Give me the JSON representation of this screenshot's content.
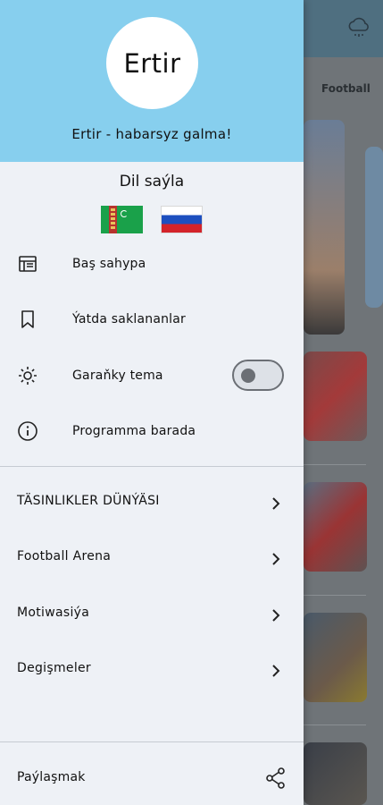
{
  "background": {
    "tab_visible": "Football"
  },
  "drawer": {
    "logo_text": "Ertir",
    "tagline": "Ertir - habarsyz galma!",
    "language": {
      "title": "Dil saýla",
      "flags": [
        "turkmenistan-flag",
        "russia-flag"
      ]
    },
    "menu": [
      {
        "label": "Baş sahypa",
        "icon": "newspaper-icon"
      },
      {
        "label": "Ýatda saklananlar",
        "icon": "bookmark-icon"
      },
      {
        "label": "Garaňky tema",
        "icon": "sun-icon"
      },
      {
        "label": "Programma barada",
        "icon": "info-icon"
      }
    ],
    "dark_mode_on": false,
    "categories": [
      {
        "label": "TÄSINLIKLER DÜNÝÄSI"
      },
      {
        "label": "Football Arena"
      },
      {
        "label": "Motiwasiýa"
      },
      {
        "label": "Degişmeler"
      }
    ],
    "share": {
      "label": "Paýlaşmak",
      "icon": "share-icon"
    }
  },
  "colors": {
    "header_bg": "#87cfee",
    "drawer_bg": "#eef1f6"
  }
}
